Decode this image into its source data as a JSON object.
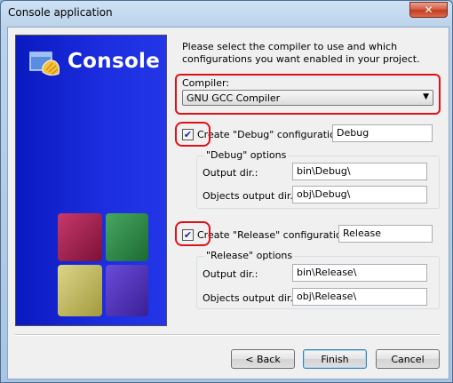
{
  "window": {
    "title": "Console application",
    "close_glyph": "✕"
  },
  "banner": {
    "title": "Console",
    "logo_icon": "codeblocks-logo-icon",
    "graphic": "colored-cubes"
  },
  "intro_text": "Please select the compiler to use and which configurations you want enabled in your project.",
  "compiler": {
    "label": "Compiler:",
    "value": "GNU GCC Compiler"
  },
  "debug": {
    "checked": true,
    "check_glyph": "✔",
    "checkbox_label": "Create \"Debug\" configuration:",
    "config_name": "Debug",
    "group_title": "\"Debug\" options",
    "output_label": "Output dir.:",
    "output_value": "bin\\Debug\\",
    "objects_label": "Objects output dir.:",
    "objects_value": "obj\\Debug\\"
  },
  "release": {
    "checked": true,
    "check_glyph": "✔",
    "checkbox_label": "Create \"Release\" configuration:",
    "config_name": "Release",
    "group_title": "\"Release\" options",
    "output_label": "Output dir.:",
    "output_value": "bin\\Release\\",
    "objects_label": "Objects output dir.:",
    "objects_value": "obj\\Release\\"
  },
  "buttons": {
    "back": "< Back",
    "finish": "Finish",
    "cancel": "Cancel"
  },
  "colors": {
    "banner_blue": "#1a2bd8",
    "highlight_red": "#e0101a"
  }
}
